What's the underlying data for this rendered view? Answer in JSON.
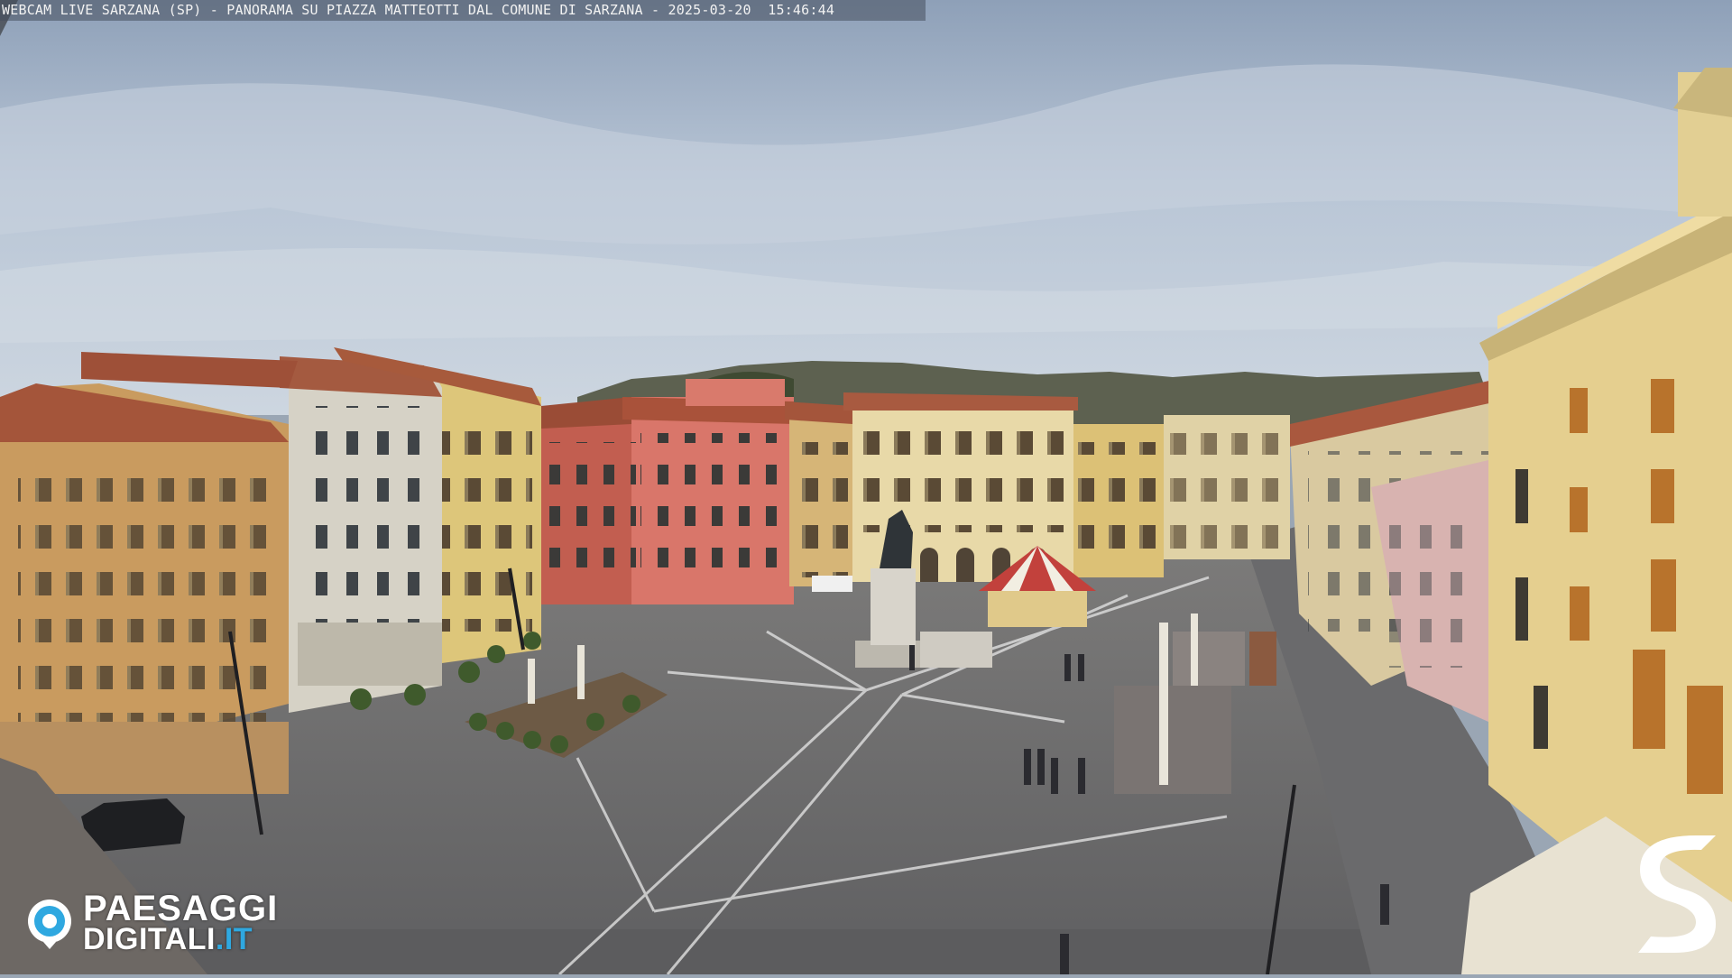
{
  "overlay": {
    "caption": "WEBCAM LIVE SARZANA (SP) - PANORAMA SU PIAZZA MATTEOTTI DAL COMUNE DI SARZANA - 2025-03-20  15:46:44"
  },
  "logo_left": {
    "brand_line1": "PAESAGGI",
    "brand_line2": "DIGITALI",
    "brand_tld": ".IT",
    "icon": "paesaggi-digitali-camera-eye-logo",
    "accent_color": "#2fa8e0"
  },
  "logo_right": {
    "icon": "stylized-s-logo",
    "color": "#ffffff"
  },
  "scene": {
    "subject": "webcam-view-of-town-piazza",
    "colors": {
      "sky": "#b7c6d8",
      "pavement": "#6e6e70",
      "building_yellow": "#e2cf93",
      "building_red": "#cf6a5c",
      "building_white": "#d9d6cc",
      "roof": "#a2533a"
    }
  }
}
